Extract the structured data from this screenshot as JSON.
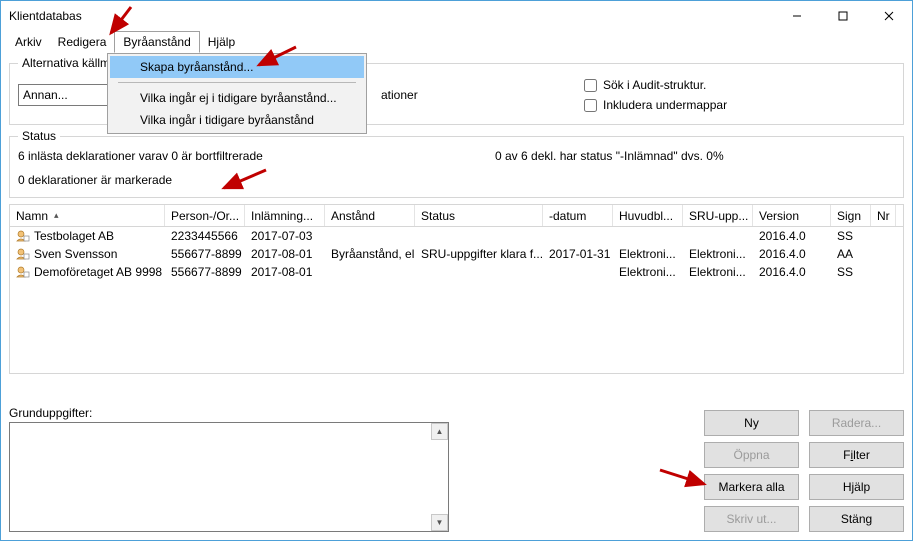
{
  "window": {
    "title": "Klientdatabas"
  },
  "menu": {
    "items": [
      "Arkiv",
      "Redigera",
      "Byråanstånd",
      "Hjälp"
    ],
    "dropdown": {
      "item0": "Skapa byråanstånd...",
      "item1": "Vilka ingår ej i tidigare byråanstånd...",
      "item2": "Vilka ingår i tidigare byråanstånd"
    }
  },
  "sources": {
    "legend": "Alternativa källmappar:",
    "input_value": "Annan...",
    "label_right_frag": "ationer",
    "chk_audit": "Sök i Audit-struktur.",
    "chk_sub": "Inkludera undermappar"
  },
  "status": {
    "legend": "Status",
    "line1_left": "6 inlästa deklarationer varav 0 är bortfiltrerade",
    "line1_right": "0 av 6 dekl. har status \"-Inlämnad\" dvs. 0%",
    "line2": "0 deklarationer är markerade"
  },
  "grid": {
    "headers": {
      "c0": "Namn",
      "c1": "Person-/Or...",
      "c2": "Inlämning...",
      "c3": "Anstånd",
      "c4": "Status",
      "c5": "-datum",
      "c6": "Huvudbl...",
      "c7": "SRU-upp...",
      "c8": "Version",
      "c9": "Sign",
      "c10": "Nr"
    },
    "rows": [
      {
        "c0": "Testbolaget AB",
        "c1": "2233445566",
        "c2": "2017-07-03",
        "c3": "",
        "c4": "",
        "c5": "",
        "c6": "",
        "c7": "",
        "c8": "2016.4.0",
        "c9": "SS",
        "c10": ""
      },
      {
        "c0": "Sven Svensson",
        "c1": "556677-8899",
        "c2": "2017-08-01",
        "c3": "Byråanstånd, el...",
        "c4": "SRU-uppgifter klara f...",
        "c5": "2017-01-31",
        "c6": "Elektroni...",
        "c7": "Elektroni...",
        "c8": "2016.4.0",
        "c9": "AA",
        "c10": ""
      },
      {
        "c0": "Demoföretaget AB 9998",
        "c1": "556677-8899",
        "c2": "2017-08-01",
        "c3": "",
        "c4": "",
        "c5": "",
        "c6": "Elektroni...",
        "c7": "Elektroni...",
        "c8": "2016.4.0",
        "c9": "SS",
        "c10": ""
      }
    ]
  },
  "grund": {
    "legend": "Grunduppgifter:"
  },
  "buttons": {
    "ny": "Ny",
    "radera": "Radera...",
    "oppna": "Öppna",
    "filter_plain": "F",
    "filter_ul": "i",
    "filter_rest": "lter",
    "markera": "Markera alla",
    "hjalp": "Hjälp",
    "skriv": "Skriv ut...",
    "stang": "Stäng"
  }
}
